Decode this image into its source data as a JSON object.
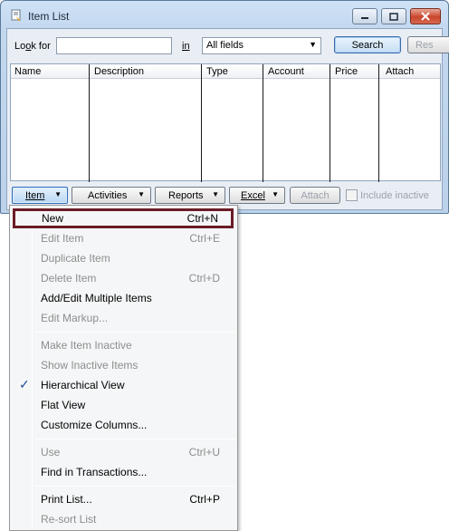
{
  "window": {
    "title": "Item List"
  },
  "search": {
    "look_for_label_prefix": "Lo",
    "look_for_label_u": "o",
    "look_for_label_suffix": "k for",
    "look_for_value": "",
    "in_label": "in",
    "field_value": "All fields",
    "search_label": "Search",
    "reset_label": "Res"
  },
  "table": {
    "columns": [
      "Name",
      "Description",
      "Type",
      "Account",
      "Price",
      "Attach"
    ]
  },
  "toolbar": {
    "item_label": "Item",
    "activities_label": "Activities",
    "reports_label": "Reports",
    "excel_label": "Excel",
    "attach_label": "Attach",
    "include_inactive_label": "Include inactive"
  },
  "menu": {
    "items": [
      {
        "label": "New",
        "shortcut": "Ctrl+N",
        "enabled": true,
        "highlighted": true
      },
      {
        "label": "Edit Item",
        "shortcut": "Ctrl+E",
        "enabled": false
      },
      {
        "label": "Duplicate Item",
        "shortcut": "",
        "enabled": false
      },
      {
        "label": "Delete Item",
        "shortcut": "Ctrl+D",
        "enabled": false
      },
      {
        "label": "Add/Edit Multiple Items",
        "shortcut": "",
        "enabled": true
      },
      {
        "label": "Edit Markup...",
        "shortcut": "",
        "enabled": false
      },
      {
        "label": "Make Item Inactive",
        "shortcut": "",
        "enabled": false
      },
      {
        "label": "Show Inactive Items",
        "shortcut": "",
        "enabled": false
      },
      {
        "label": "Hierarchical View",
        "shortcut": "",
        "enabled": true,
        "checked": true
      },
      {
        "label": "Flat View",
        "shortcut": "",
        "enabled": true
      },
      {
        "label": "Customize Columns...",
        "shortcut": "",
        "enabled": true
      },
      {
        "label": "Use",
        "shortcut": "Ctrl+U",
        "enabled": false
      },
      {
        "label": "Find in Transactions...",
        "shortcut": "",
        "enabled": true
      },
      {
        "label": "Print List...",
        "shortcut": "Ctrl+P",
        "enabled": true
      },
      {
        "label": "Re-sort List",
        "shortcut": "",
        "enabled": false
      }
    ]
  },
  "colors": {
    "highlight_border": "#6b1c26",
    "checkmark": "#1f4e96",
    "disabled_text": "#8d8d8d"
  }
}
